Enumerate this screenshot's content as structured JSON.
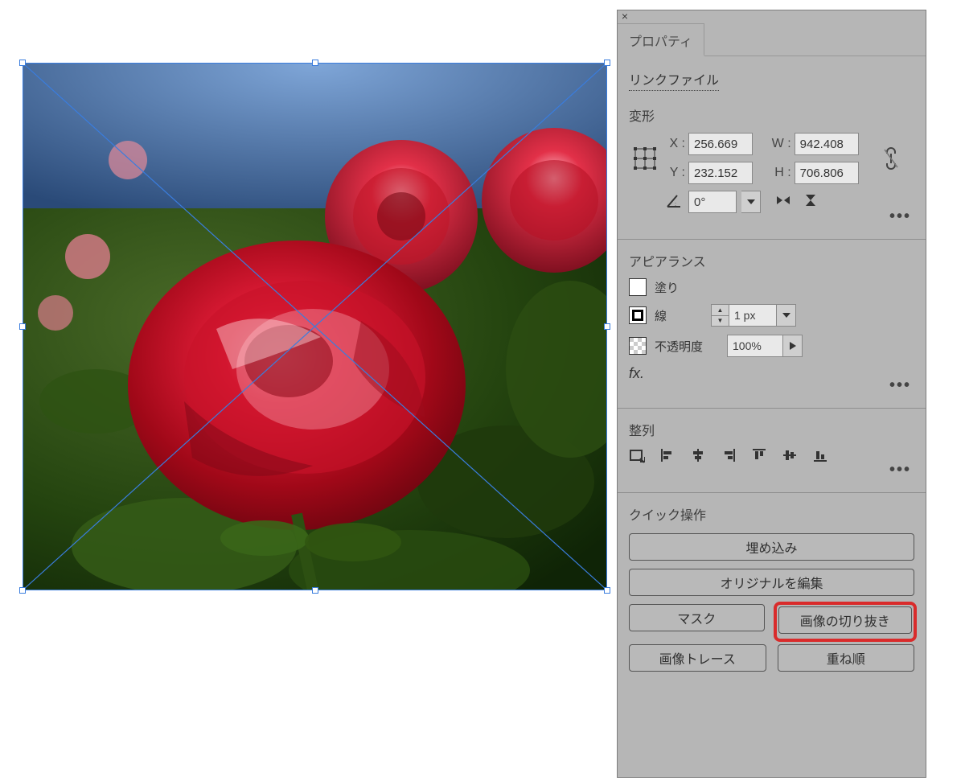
{
  "panel": {
    "tab_properties": "プロパティ",
    "link_file": "リンクファイル",
    "transform": {
      "title": "変形",
      "x_label": "X :",
      "y_label": "Y :",
      "w_label": "W :",
      "h_label": "H :",
      "x": "256.669",
      "y": "232.152",
      "w": "942.408",
      "h": "706.806",
      "angle": "0°"
    },
    "appearance": {
      "title": "アピアランス",
      "fill": "塗り",
      "stroke": "線",
      "stroke_width": "1 px",
      "opacity_label": "不透明度",
      "opacity": "100%"
    },
    "align": {
      "title": "整列"
    },
    "quick": {
      "title": "クイック操作",
      "embed": "埋め込み",
      "edit_original": "オリジナルを編集",
      "mask": "マスク",
      "crop_image": "画像の切り抜き",
      "image_trace": "画像トレース",
      "arrange": "重ね順"
    }
  }
}
